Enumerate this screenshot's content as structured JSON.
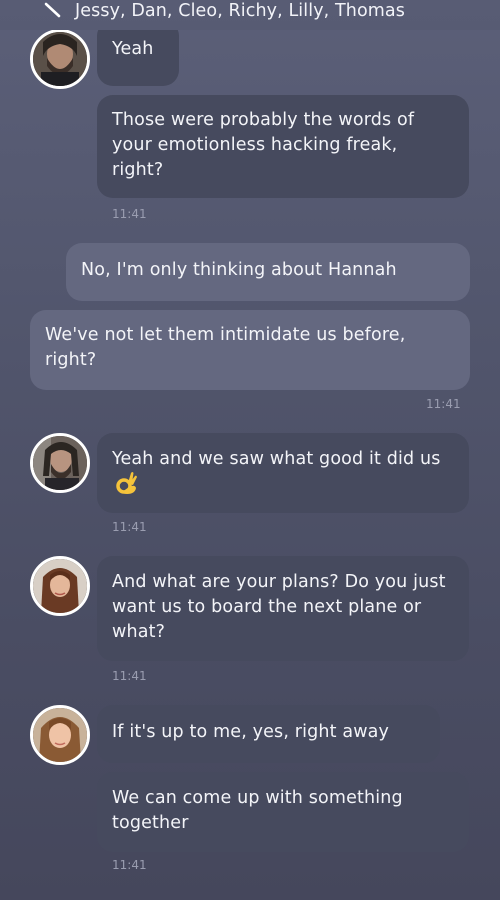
{
  "header": {
    "title": "Jessy, Dan, Cleo, Richy, Lilly, Thomas",
    "back_icon": "back-arrow-icon"
  },
  "messages": [
    {
      "sender": "incoming",
      "text": "Yeah",
      "avatar": "male-bearded-avatar"
    },
    {
      "sender": "incoming",
      "text": "Those were probably the words of your emotionless hacking freak, right?",
      "time": "11:41"
    },
    {
      "sender": "outgoing",
      "text": "No, I'm only thinking about Hannah"
    },
    {
      "sender": "outgoing",
      "text": "We've not let them intimidate us before, right?",
      "time": "11:41"
    },
    {
      "sender": "incoming",
      "text": "Yeah and we saw what good it did us",
      "emoji": "ok-hand-emoji",
      "avatar": "male-bearded-avatar",
      "time": "11:41"
    },
    {
      "sender": "incoming",
      "text": "And what are your plans? Do you just want us to board the next plane or what?",
      "avatar": "female-brown-hair-avatar",
      "time": "11:41"
    },
    {
      "sender": "incoming",
      "text": "If it's up to me, yes, right away",
      "avatar": "female-blonde-avatar"
    },
    {
      "sender": "incoming",
      "text": "We can come up with something together",
      "time": "11:41"
    }
  ],
  "colors": {
    "bubble_incoming": "#464a5e",
    "bubble_outgoing": "#646880",
    "timestamp": "#9a9db0",
    "avatar_border": "#ffffff"
  }
}
